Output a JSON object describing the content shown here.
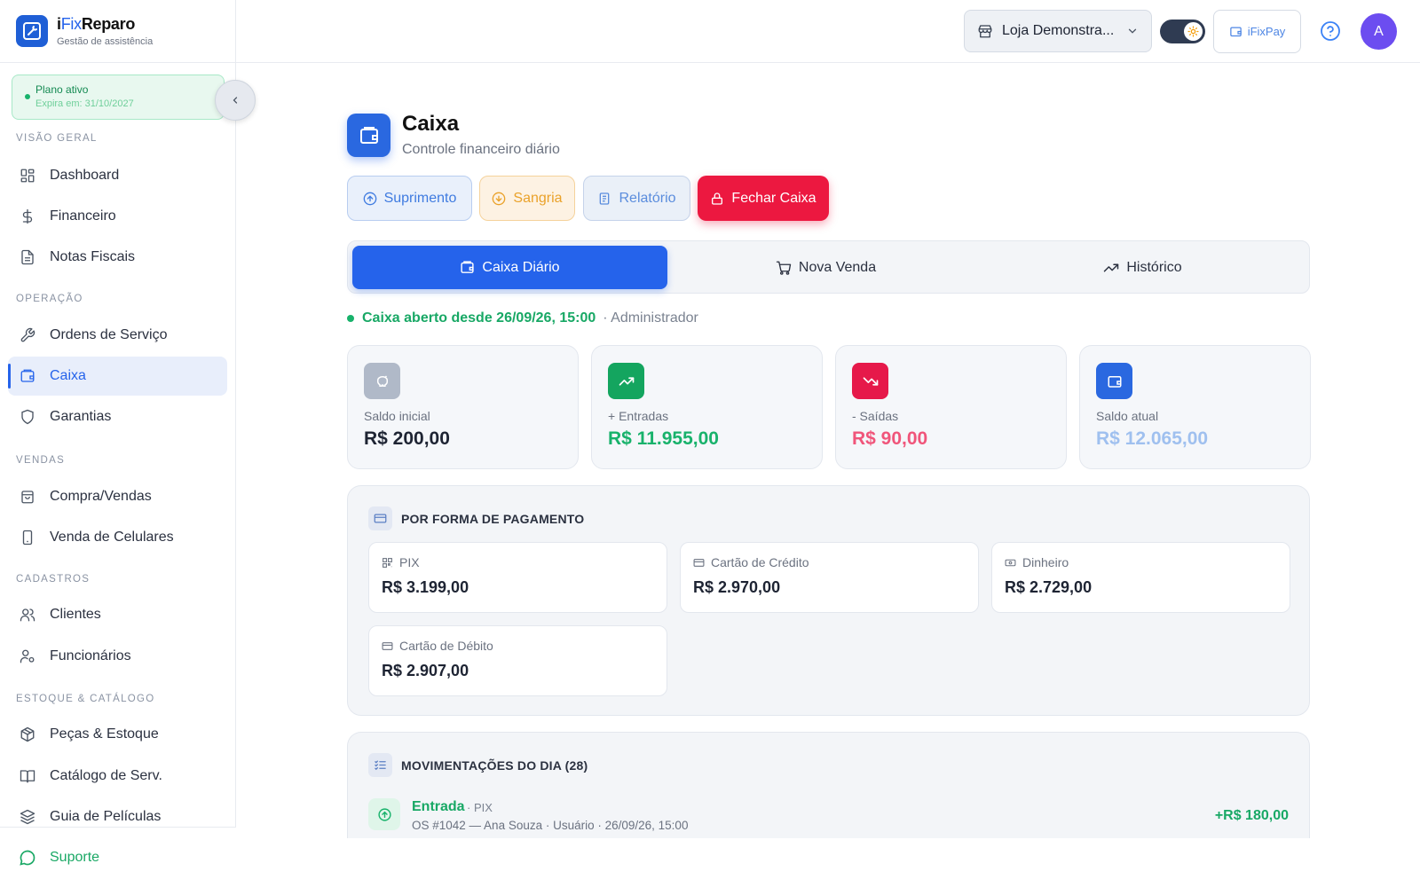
{
  "brand": {
    "name_prefix": "i",
    "name_fix": "Fix",
    "name_suffix": "Reparo",
    "subtitle": "Gestão de assistência"
  },
  "plan": {
    "title": "Plano ativo",
    "expires": "Expira em: 31/10/2027"
  },
  "sidebar": {
    "sections": [
      {
        "label": "VISÃO GERAL"
      },
      {
        "label": "OPERAÇÃO"
      },
      {
        "label": "VENDAS"
      },
      {
        "label": "CADASTROS"
      },
      {
        "label": "ESTOQUE & CATÁLOGO"
      }
    ],
    "items": [
      {
        "label": "Dashboard",
        "icon": "dashboard-icon"
      },
      {
        "label": "Financeiro",
        "icon": "dollar-icon"
      },
      {
        "label": "Notas Fiscais",
        "icon": "document-icon"
      },
      {
        "label": "Ordens de Serviço",
        "icon": "wrench-icon"
      },
      {
        "label": "Caixa",
        "icon": "wallet-icon",
        "active": true
      },
      {
        "label": "Garantias",
        "icon": "shield-icon"
      },
      {
        "label": "Compra/Vendas",
        "icon": "shopping-bag-icon"
      },
      {
        "label": "Venda de Celulares",
        "icon": "smartphone-icon"
      },
      {
        "label": "Clientes",
        "icon": "users-icon"
      },
      {
        "label": "Funcionários",
        "icon": "user-cog-icon"
      },
      {
        "label": "Peças & Estoque",
        "icon": "package-icon"
      },
      {
        "label": "Catálogo de Serv.",
        "icon": "book-icon"
      },
      {
        "label": "Guia de Películas",
        "icon": "layers-icon"
      }
    ],
    "support_label": "Suporte"
  },
  "topbar": {
    "store_label": "Loja Demonstra...",
    "pay_label": "iFixPay",
    "avatar_initial": "A"
  },
  "page": {
    "title": "Caixa",
    "subtitle": "Controle financeiro diário"
  },
  "actions": {
    "suprimento": "Suprimento",
    "sangria": "Sangria",
    "relatorio": "Relatório",
    "fechar": "Fechar Caixa"
  },
  "tabs": [
    {
      "label": "Caixa Diário",
      "active": true
    },
    {
      "label": "Nova Venda"
    },
    {
      "label": "Histórico"
    }
  ],
  "status": {
    "text": "Caixa aberto desde 26/09/26, 15:00",
    "user": "· Administrador"
  },
  "stats": [
    {
      "label": "Saldo inicial",
      "value": "R$ 200,00",
      "color": "#1e2433"
    },
    {
      "label": "+ Entradas",
      "value": "R$ 11.955,00",
      "color": "#18b26b"
    },
    {
      "label": "- Saídas",
      "value": "R$ 90,00",
      "color": "#f0557a"
    },
    {
      "label": "Saldo atual",
      "value": "R$ 12.065,00",
      "color": "#9fc0ef"
    }
  ],
  "payments": {
    "title": "POR FORMA DE PAGAMENTO",
    "items": [
      {
        "label": "PIX",
        "value": "R$ 3.199,00",
        "icon": "qr-code-icon"
      },
      {
        "label": "Cartão de Crédito",
        "value": "R$ 2.970,00",
        "icon": "credit-card-icon"
      },
      {
        "label": "Dinheiro",
        "value": "R$ 2.729,00",
        "icon": "cash-icon"
      },
      {
        "label": "Cartão de Débito",
        "value": "R$ 2.907,00",
        "icon": "credit-card-icon"
      }
    ]
  },
  "movements": {
    "title": "MOVIMENTAÇÕES DO DIA (28)",
    "items": [
      {
        "type": "Entrada",
        "method": "· PIX",
        "description": "OS #1042 — Ana Souza · Usuário · 26/09/26, 15:00",
        "amount": "+R$ 180,00"
      }
    ]
  },
  "colors": {
    "primary": "#2563eb",
    "success": "#18b26b",
    "danger": "#ec1840",
    "warning": "#eaa22a"
  }
}
